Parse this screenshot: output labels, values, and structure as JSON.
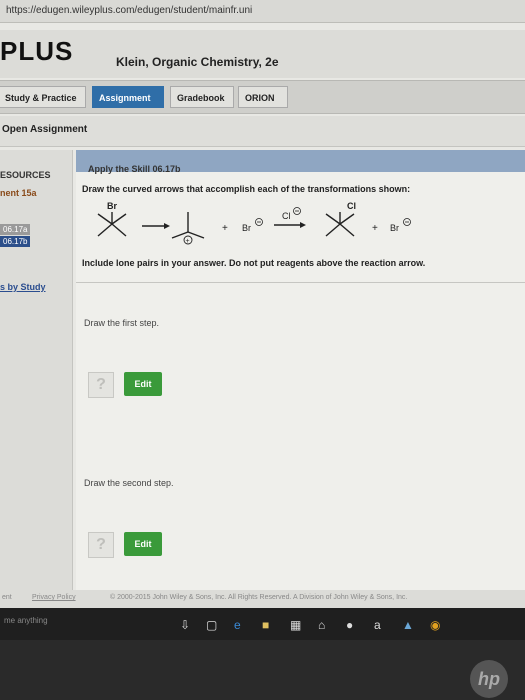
{
  "browser": {
    "url": "https://edugen.wileyplus.com/edugen/student/mainfr.uni"
  },
  "header": {
    "brand": "PLUS",
    "course": "Klein, Organic Chemistry, 2e"
  },
  "tabs": [
    {
      "label": "Study & Practice"
    },
    {
      "label": "Assignment"
    },
    {
      "label": "Gradebook"
    },
    {
      "label": "ORION"
    }
  ],
  "subheader": {
    "title": "Open Assignment"
  },
  "sidebar": {
    "resources": "ESOURCES",
    "assignment": "nent 15a",
    "item1": "06.17a",
    "item2": "06.17b",
    "by_study": "s by Study"
  },
  "question": {
    "heading": "Apply the Skill 06.17b",
    "instruction": "Draw the curved arrows that accomplish each of the transformations shown:",
    "note": "Include lone pairs in your answer. Do not put reagents above the reaction arrow.",
    "reaction": {
      "br_label": "Br",
      "plus1": "+",
      "bromide1": "Br",
      "chloride": "Cl",
      "cl_label": "Cl",
      "plus2": "+",
      "bromide2": "Br",
      "charge_neg": "⊖",
      "charge_pos": "⊕"
    },
    "step1": {
      "label": "Draw the first step.",
      "help": "?",
      "edit": "Edit"
    },
    "step2": {
      "label": "Draw the second step.",
      "help": "?",
      "edit": "Edit"
    }
  },
  "footer": {
    "left": "ent",
    "privacy": "Privacy Policy",
    "copyright": "© 2000-2015 John Wiley & Sons, Inc. All Rights Reserved. A Division of John Wiley & Sons, Inc."
  },
  "taskbar": {
    "search": "me anything"
  }
}
